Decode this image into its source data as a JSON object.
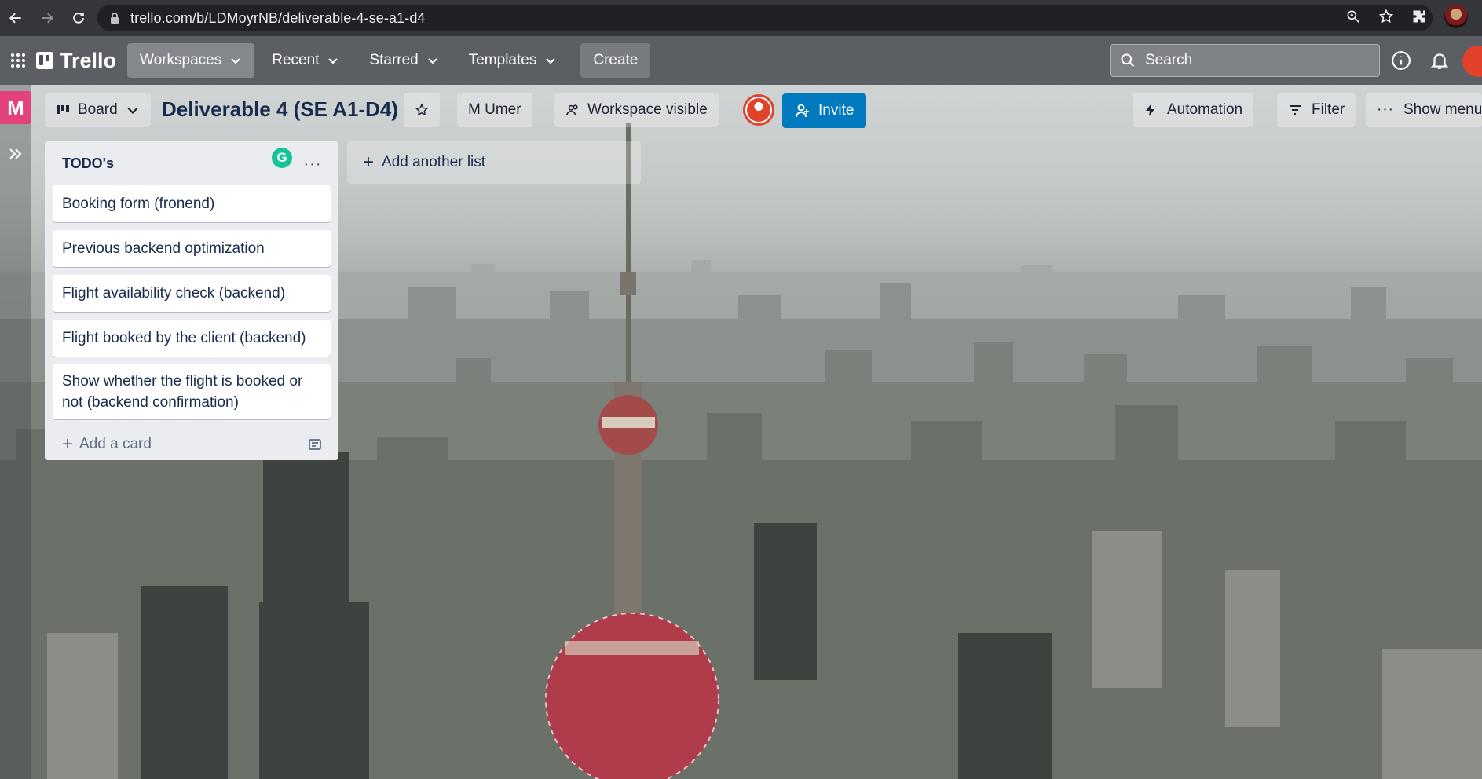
{
  "browser": {
    "url": "trello.com/b/LDMoyrNB/deliverable-4-se-a1-d4"
  },
  "header": {
    "logo": "Trello",
    "nav": [
      "Workspaces",
      "Recent",
      "Starred",
      "Templates"
    ],
    "create_label": "Create",
    "search_placeholder": "Search"
  },
  "board_bar": {
    "workspace_initial": "M",
    "view_label": "Board",
    "title": "Deliverable 4 (SE A1-D4)",
    "owner": "M Umer",
    "visibility": "Workspace visible",
    "invite_label": "Invite",
    "automation_label": "Automation",
    "filter_label": "Filter",
    "menu_label": "Show menu"
  },
  "lists": [
    {
      "title": "TODO's",
      "cards": [
        "Booking form (fronend)",
        "Previous backend optimization",
        "Flight availability check (backend)",
        "Flight booked by the client (backend)",
        "Show whether the flight is booked or not (backend confirmation)"
      ],
      "add_card_label": "Add a card",
      "grammarly": "G"
    }
  ],
  "add_list_label": "Add another list"
}
